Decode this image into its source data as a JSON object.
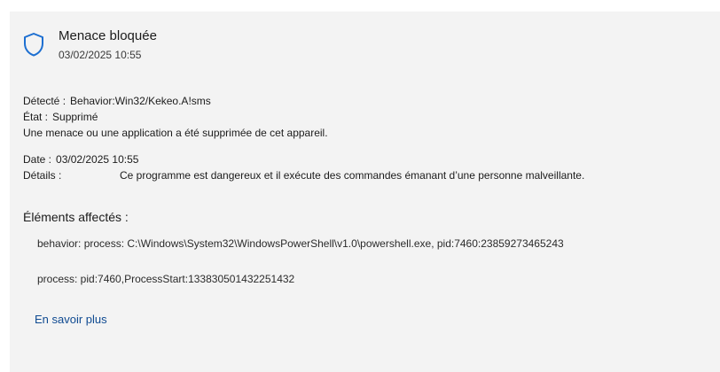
{
  "header": {
    "title": "Menace bloquée",
    "datetime": "03/02/2025 10:55",
    "icon": "shield-icon"
  },
  "summary": {
    "detected_label": "Détecté :",
    "detected_value": "Behavior:Win32/Kekeo.A!sms",
    "status_label": "État :",
    "status_value": "Supprimé",
    "description": "Une menace ou une application a été supprimée de cet appareil."
  },
  "info": {
    "date_label": "Date :",
    "date_value": "03/02/2025 10:55",
    "details_label": "Détails :",
    "details_value": "Ce programme est dangereux et il exécute des commandes émanant d’une personne malveillante."
  },
  "affected": {
    "title": "Éléments affectés :",
    "items": [
      "behavior: process: C:\\Windows\\System32\\WindowsPowerShell\\v1.0\\powershell.exe, pid:7460:23859273465243",
      "process: pid:7460,ProcessStart:133830501432251432"
    ]
  },
  "learn_more": "En savoir plus",
  "colors": {
    "accent": "#0f4a91",
    "shield_stroke": "#1d6fd1",
    "panel_bg": "#f3f3f3"
  }
}
